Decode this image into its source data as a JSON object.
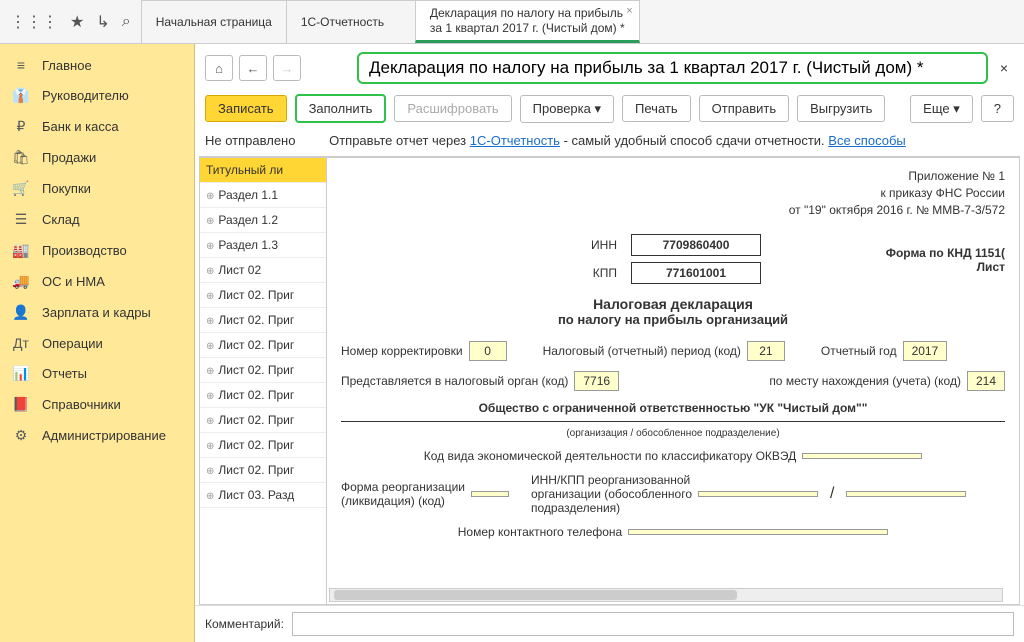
{
  "topIcons": {
    "apps": "⋮⋮⋮",
    "star": "★",
    "history": "↳",
    "search": "⌕"
  },
  "tabs": [
    {
      "label": "Начальная страница"
    },
    {
      "label": "1С-Отчетность"
    },
    {
      "label1": "Декларация по налогу на прибыль",
      "label2": "за 1 квартал 2017 г. (Чистый дом) *",
      "close": "×"
    }
  ],
  "sidebar": [
    {
      "icon": "≡",
      "label": "Главное"
    },
    {
      "icon": "👔",
      "label": "Руководителю"
    },
    {
      "icon": "₽",
      "label": "Банк и касса"
    },
    {
      "icon": "🛍",
      "label": "Продажи"
    },
    {
      "icon": "🛒",
      "label": "Покупки"
    },
    {
      "icon": "☰",
      "label": "Склад"
    },
    {
      "icon": "🏭",
      "label": "Производство"
    },
    {
      "icon": "🚚",
      "label": "ОС и НМА"
    },
    {
      "icon": "👤",
      "label": "Зарплата и кадры"
    },
    {
      "icon": "Дт",
      "label": "Операции"
    },
    {
      "icon": "📊",
      "label": "Отчеты"
    },
    {
      "icon": "📕",
      "label": "Справочники"
    },
    {
      "icon": "⚙",
      "label": "Администрирование"
    }
  ],
  "nav": {
    "home": "⌂",
    "back": "←",
    "fwd": "→"
  },
  "docTitle": "Декларация по налогу на прибыль за 1 квартал 2017 г. (Чистый дом) *",
  "closeX": "×",
  "toolbar": {
    "save": "Записать",
    "fill": "Заполнить",
    "decode": "Расшифровать",
    "check": "Проверка",
    "print": "Печать",
    "send": "Отправить",
    "export": "Выгрузить",
    "more": "Еще",
    "help": "?"
  },
  "status": {
    "notSent": "Не отправлено",
    "hint1": "Отправьте отчет через ",
    "link1": "1С-Отчетность",
    "hint2": " - самый удобный способ сдачи отчетности. ",
    "link2": "Все способы"
  },
  "sections": [
    "Титульный ли",
    "Раздел 1.1",
    "Раздел 1.2",
    "Раздел 1.3",
    "Лист 02",
    "Лист 02. Приг",
    "Лист 02. Приг",
    "Лист 02. Приг",
    "Лист 02. Приг",
    "Лист 02. Приг",
    "Лист 02. Приг",
    "Лист 02. Приг",
    "Лист 02. Приг",
    "Лист 03. Разд"
  ],
  "form": {
    "header": {
      "l1": "Приложение № 1",
      "l2": "к приказу ФНС России",
      "l3": "от \"19\" октября 2016 г. № ММВ-7-3/572"
    },
    "innLabel": "ИНН",
    "inn": "7709860400",
    "kppLabel": "КПП",
    "kpp": "771601001",
    "kndLabel": "Форма по КНД 1151(",
    "sheetLabel": "Лист",
    "title": "Налоговая декларация",
    "subtitle": "по налогу на прибыль организаций",
    "corrLabel": "Номер корректировки",
    "corr": "0",
    "periodLabel": "Налоговый (отчетный) период (код)",
    "period": "21",
    "yearLabel": "Отчетный год",
    "year": "2017",
    "taxOrgLabel": "Представляется в налоговый орган (код)",
    "taxOrg": "7716",
    "placeLabel": "по месту нахождения (учета) (код)",
    "place": "214",
    "orgName": "Общество с ограниченной ответственностью \"УК \"Чистый дом\"\"",
    "orgSub": "(организация / обособленное подразделение)",
    "okvedLabel": "Код вида экономической деятельности по классификатору ОКВЭД",
    "reorgLabel1": "Форма реорганизации",
    "reorgLabel2": "(ликвидация) (код)",
    "reorgKppLabel1": "ИНН/КПП реорганизованной",
    "reorgKppLabel2": "организации (обособленного",
    "reorgKppLabel3": "подразделения)",
    "phoneLabel": "Номер контактного телефона"
  },
  "commentLabel": "Комментарий:"
}
